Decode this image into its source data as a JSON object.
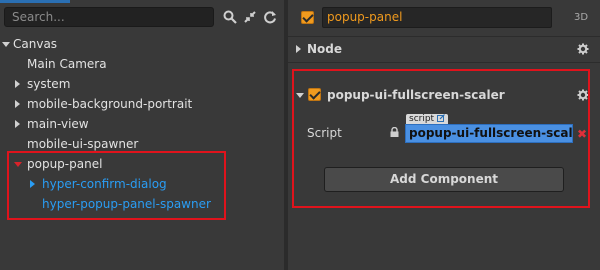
{
  "hierarchy": {
    "search_placeholder": "Search...",
    "tree": [
      {
        "label": "Canvas"
      },
      {
        "label": "Main Camera"
      },
      {
        "label": "system"
      },
      {
        "label": "mobile-background-portrait"
      },
      {
        "label": "main-view"
      },
      {
        "label": "mobile-ui-spawner"
      },
      {
        "label": "popup-panel"
      },
      {
        "label": "hyper-confirm-dialog"
      },
      {
        "label": "hyper-popup-panel-spawner"
      }
    ]
  },
  "inspector": {
    "node_name": "popup-panel",
    "mode_tag": "3D",
    "node_section": "Node",
    "component": {
      "title": "popup-ui-fullscreen-scaler",
      "property_label": "Script",
      "script_tag": "script",
      "script_value": "popup-ui-fullscreen-scaler",
      "remove_symbol": "✖"
    },
    "add_component_label": "Add Component"
  },
  "colors": {
    "accent_orange": "#f09a1e",
    "selection_blue": "#2a9df4",
    "highlight_red": "#e0131c"
  }
}
